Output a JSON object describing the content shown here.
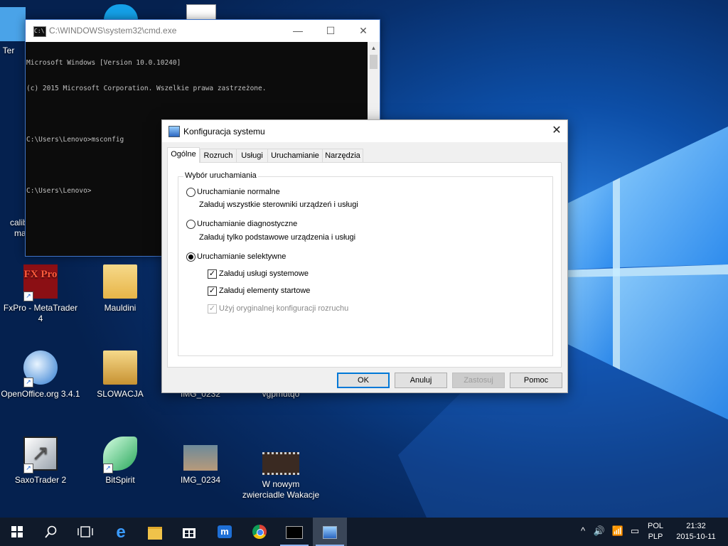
{
  "desktop": {
    "icons": [
      {
        "id": "ter",
        "label": "Ter"
      },
      {
        "id": "cal",
        "label": "calib"
      },
      {
        "id": "cal2",
        "label": "ma"
      },
      {
        "id": "fxpro",
        "label": "FxPro - MetaTrader 4",
        "badge": "FX Pro"
      },
      {
        "id": "mauldini",
        "label": "Mauldini"
      },
      {
        "id": "openoffice",
        "label": "OpenOffice.org 3.4.1"
      },
      {
        "id": "slowacja",
        "label": "SLOWACJA"
      },
      {
        "id": "img0232",
        "label": "IMG_0232"
      },
      {
        "id": "vgpmutqo",
        "label": "vgpmutqo"
      },
      {
        "id": "saxo",
        "label": "SaxoTrader 2"
      },
      {
        "id": "bitspirit",
        "label": "BitSpirit"
      },
      {
        "id": "img0234",
        "label": "IMG_0234"
      },
      {
        "id": "wnowym",
        "label": "W nowym zwierciadle Wakacje"
      }
    ]
  },
  "cmd": {
    "title": "C:\\WINDOWS\\system32\\cmd.exe",
    "lines": [
      "Microsoft Windows [Version 10.0.10240]",
      "(c) 2015 Microsoft Corporation. Wszelkie prawa zastrzeżone.",
      "",
      "C:\\Users\\Lenovo>msconfig",
      "",
      "C:\\Users\\Lenovo>"
    ],
    "minimize": "—",
    "maximize": "☐",
    "close": "✕"
  },
  "msconfig": {
    "title": "Konfiguracja systemu",
    "close": "✕",
    "tabs": [
      "Ogólne",
      "Rozruch",
      "Usługi",
      "Uruchamianie",
      "Narzędzia"
    ],
    "active_tab": "Ogólne",
    "group_label": "Wybór uruchamiania",
    "options": {
      "normal": {
        "label": "Uruchamianie normalne",
        "desc": "Załaduj wszystkie sterowniki urządzeń i usługi",
        "selected": false
      },
      "diagnostic": {
        "label": "Uruchamianie diagnostyczne",
        "desc": "Załaduj tylko podstawowe urządzenia i usługi",
        "selected": false
      },
      "selective": {
        "label": "Uruchamianie selektywne",
        "selected": true
      }
    },
    "checks": {
      "system_services": {
        "label": "Załaduj usługi systemowe",
        "checked": true
      },
      "startup_items": {
        "label": "Załaduj elementy startowe",
        "checked": true
      },
      "original_boot": {
        "label": "Użyj oryginalnej konfiguracji rozruchu",
        "checked": true,
        "disabled": true
      }
    },
    "buttons": {
      "ok": "OK",
      "cancel": "Anuluj",
      "apply": "Zastosuj",
      "help": "Pomoc"
    }
  },
  "taskbar": {
    "language": "POL",
    "layout": "PLP",
    "time": "21:32",
    "date": "2015-10-11",
    "items": [
      "start-icon",
      "search-icon",
      "task-view-icon",
      "edge-icon",
      "file-explorer-icon",
      "store-icon",
      "maxthon-icon",
      "chrome-icon",
      "cmd-icon",
      "msconfig-icon"
    ]
  },
  "colors": {
    "accent": "#0078d7",
    "taskbar": "#101a2a",
    "wallpaper": "#0b2f6b"
  }
}
